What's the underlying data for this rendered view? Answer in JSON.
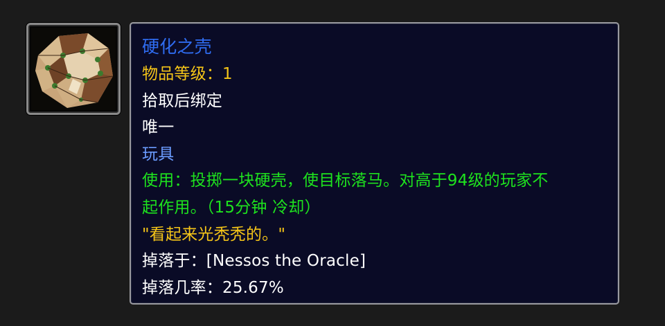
{
  "colors": {
    "background": "#1b1b1b",
    "tooltip_bg": "#0a0b26",
    "tooltip_border": "#9a9aa0",
    "item_name": "#2f6cf0",
    "item_level": "#f5c518",
    "white_text": "#ffffff",
    "toy_label": "#6b9cff",
    "use_green": "#1ee31e",
    "flavor_yellow": "#f5c518"
  },
  "item": {
    "icon_name": "hardened-shell-icon",
    "name": "硬化之壳",
    "item_level": "物品等级：1",
    "binding": "拾取后绑定",
    "unique": "唯一",
    "type": "玩具",
    "use_line1": "使用：投掷一块硬壳，使目标落马。对高于94级的玩家不",
    "use_line2": "起作用。（15分钟 冷却）",
    "flavor": "\"看起来光秃秃的。\"",
    "drop_source": "掉落于：[Nessos the Oracle]",
    "drop_rate": "掉落几率：25.67%"
  }
}
